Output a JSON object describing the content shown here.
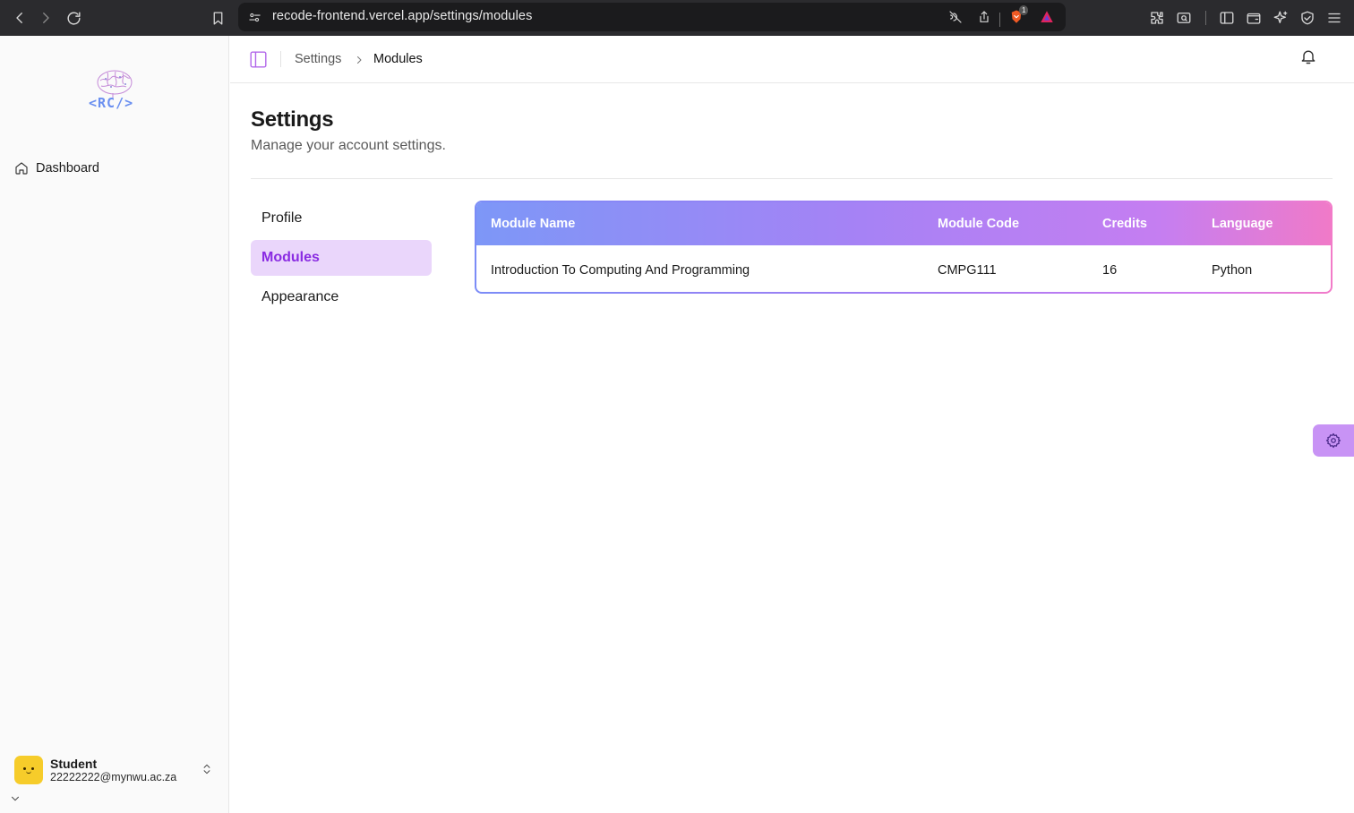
{
  "browser": {
    "url": "recode-frontend.vercel.app/settings/modules",
    "brave_badge": "1"
  },
  "sidebar": {
    "logo_text": "<RC/>",
    "items": [
      {
        "label": "Dashboard",
        "icon": "home-icon"
      }
    ],
    "user": {
      "name": "Student",
      "email": "22222222@mynwu.ac.za"
    }
  },
  "topbar": {
    "breadcrumb": [
      "Settings",
      "Modules"
    ]
  },
  "page": {
    "title": "Settings",
    "subtitle": "Manage your account settings."
  },
  "settings_nav": {
    "items": [
      "Profile",
      "Modules",
      "Appearance"
    ],
    "active": "Modules"
  },
  "modules_table": {
    "headers": [
      "Module Name",
      "Module Code",
      "Credits",
      "Language"
    ],
    "rows": [
      [
        "Introduction To Computing And Programming",
        "CMPG111",
        "16",
        "Python"
      ]
    ]
  },
  "colors": {
    "accent": "#8a2be2",
    "active_bg": "#ead6fb",
    "avatar": "#f6cc2a",
    "gradient_start": "#7d97f7",
    "gradient_end": "#f07ac8"
  }
}
